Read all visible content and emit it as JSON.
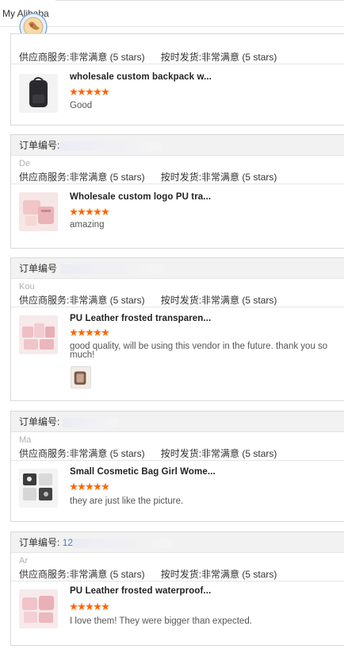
{
  "header": {
    "brand": "My Alibaba"
  },
  "labels": {
    "order_no": "订单编号:",
    "order_no_short": "订单编号",
    "supplier_service": "供应商服务:非常满意 (5 stars)",
    "on_time": "按时发货:非常满意 (5 stars)"
  },
  "colors": {
    "star": "#ff6600",
    "order_link": "#3a7bd5"
  },
  "reviews": [
    {
      "buyer": "",
      "order_no": "",
      "product": "wholesale custom backpack w...",
      "rating": 5,
      "text": "Good",
      "photo_icon": "backpack-thumbnail"
    },
    {
      "buyer": "De",
      "order_no": "",
      "product": "Wholesale custom logo PU tra...",
      "rating": 5,
      "text": "amazing",
      "photo_icon": "pink-cosmetic-bag-thumbnail"
    },
    {
      "buyer": "Kou",
      "order_no": "",
      "product": "PU Leather frosted transparen...",
      "rating": 5,
      "text": "good quality,         will be using this vendor in the future. thank you so much!",
      "photo_icon": "pink-cosmetic-bag-set-thumbnail"
    },
    {
      "buyer": "Ma",
      "order_no": "",
      "product": "Small Cosmetic Bag Girl Wome...",
      "rating": 5,
      "text": "they are just like the picture.",
      "photo_icon": "cosmetic-bag-grid-thumbnail"
    },
    {
      "buyer": "Ar",
      "order_no": "12",
      "product": "PU Leather frosted waterproof...",
      "rating": 5,
      "text": "I love them! They were bigger than expected.",
      "photo_icon": "pink-waterproof-bag-thumbnail"
    }
  ]
}
